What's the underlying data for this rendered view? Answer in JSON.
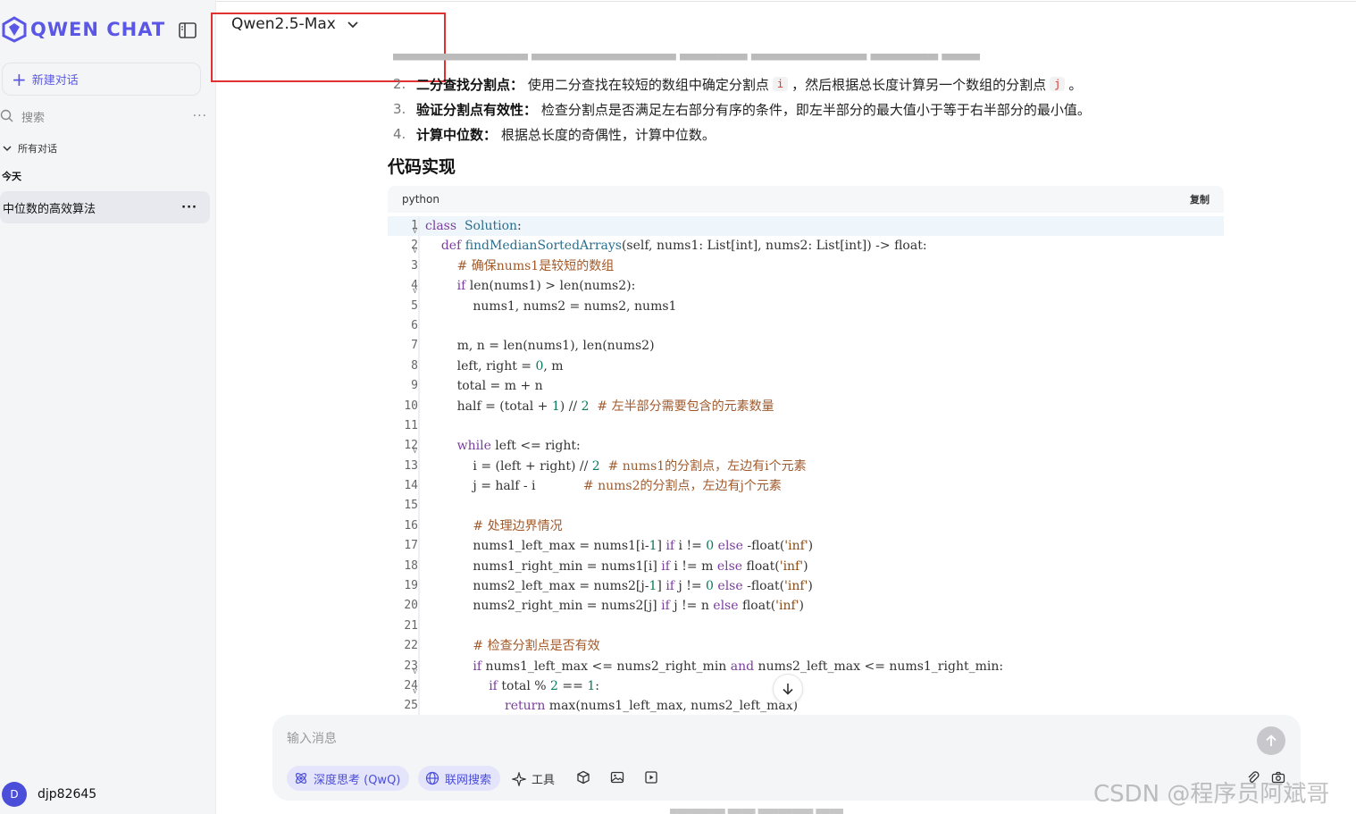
{
  "app": {
    "logo_text": "QWEN CHAT"
  },
  "sidebar": {
    "new_chat_label": "新建对话",
    "search_placeholder": "搜索",
    "all_chats_label": "所有对话",
    "group_today": "今天",
    "conversations": [
      {
        "title": "中位数的高效算法"
      }
    ],
    "user_initial": "D",
    "username": "djp82645"
  },
  "header": {
    "model_name": "Qwen2.5-Max"
  },
  "article": {
    "steps": [
      {
        "num": "2.",
        "title": "二分查找分割点",
        "sep": "：",
        "text_a": "使用二分查找在较短的数组中确定分割点",
        "code_a": "i",
        "text_b": "，然后根据总长度计算另一个数组的分割点",
        "code_b": "j",
        "text_c": "。"
      },
      {
        "num": "3.",
        "title": "验证分割点有效性",
        "sep": "：",
        "text_a": "检查分割点是否满足左右部分有序的条件，即左半部分的最大值小于等于右半部分的最小值。"
      },
      {
        "num": "4.",
        "title": "计算中位数",
        "sep": "：",
        "text_a": "根据总长度的奇偶性，计算中位数。"
      }
    ],
    "section_title": "代码实现",
    "code_block": {
      "language": "python",
      "copy_label": "复制",
      "lines": [
        [
          [
            "kw",
            "class"
          ],
          [
            "",
            "  "
          ],
          [
            "cls",
            "Solution"
          ],
          [
            "",
            ":"
          ]
        ],
        [
          [
            "",
            "    "
          ],
          [
            "kw",
            "def"
          ],
          [
            "",
            " "
          ],
          [
            "cls",
            "findMedianSortedArrays"
          ],
          [
            "",
            "(self, nums1: List[int], nums2: List[int]) -> float:"
          ]
        ],
        [
          [
            "",
            "        "
          ],
          [
            "cmt",
            "# 确保nums1是较短的数组"
          ]
        ],
        [
          [
            "",
            "        "
          ],
          [
            "kw",
            "if"
          ],
          [
            "",
            " len(nums1) > len(nums2):"
          ]
        ],
        [
          [
            "",
            "            nums1, nums2 = nums2, nums1"
          ]
        ],
        [
          [
            "",
            ""
          ]
        ],
        [
          [
            "",
            "        m, n = len(nums1), len(nums2)"
          ]
        ],
        [
          [
            "",
            "        left, right = "
          ],
          [
            "num",
            "0"
          ],
          [
            "",
            ", m"
          ]
        ],
        [
          [
            "",
            "        total = m + n"
          ]
        ],
        [
          [
            "",
            "        half = (total + "
          ],
          [
            "num",
            "1"
          ],
          [
            "",
            ") // "
          ],
          [
            "num",
            "2"
          ],
          [
            "",
            "  "
          ],
          [
            "cmt",
            "# 左半部分需要包含的元素数量"
          ]
        ],
        [
          [
            "",
            ""
          ]
        ],
        [
          [
            "",
            "        "
          ],
          [
            "kw",
            "while"
          ],
          [
            "",
            " left <= right:"
          ]
        ],
        [
          [
            "",
            "            i = (left + right) // "
          ],
          [
            "num",
            "2"
          ],
          [
            "",
            "  "
          ],
          [
            "cmt",
            "# nums1的分割点，左边有i个元素"
          ]
        ],
        [
          [
            "",
            "            j = half - i            "
          ],
          [
            "cmt",
            "# nums2的分割点，左边有j个元素"
          ]
        ],
        [
          [
            "",
            ""
          ]
        ],
        [
          [
            "",
            "            "
          ],
          [
            "cmt",
            "# 处理边界情况"
          ]
        ],
        [
          [
            "",
            "            nums1_left_max = nums1[i-"
          ],
          [
            "num",
            "1"
          ],
          [
            "",
            "] "
          ],
          [
            "kw",
            "if"
          ],
          [
            "",
            " i != "
          ],
          [
            "num",
            "0"
          ],
          [
            "",
            " "
          ],
          [
            "kw",
            "else"
          ],
          [
            "",
            " -float("
          ],
          [
            "str",
            "'inf'"
          ],
          [
            "",
            ")"
          ]
        ],
        [
          [
            "",
            "            nums1_right_min = nums1[i] "
          ],
          [
            "kw",
            "if"
          ],
          [
            "",
            " i != m "
          ],
          [
            "kw",
            "else"
          ],
          [
            "",
            " float("
          ],
          [
            "str",
            "'inf'"
          ],
          [
            "",
            ")"
          ]
        ],
        [
          [
            "",
            "            nums2_left_max = nums2[j-"
          ],
          [
            "num",
            "1"
          ],
          [
            "",
            "] "
          ],
          [
            "kw",
            "if"
          ],
          [
            "",
            " j != "
          ],
          [
            "num",
            "0"
          ],
          [
            "",
            " "
          ],
          [
            "kw",
            "else"
          ],
          [
            "",
            " -float("
          ],
          [
            "str",
            "'inf'"
          ],
          [
            "",
            ")"
          ]
        ],
        [
          [
            "",
            "            nums2_right_min = nums2[j] "
          ],
          [
            "kw",
            "if"
          ],
          [
            "",
            " j != n "
          ],
          [
            "kw",
            "else"
          ],
          [
            "",
            " float("
          ],
          [
            "str",
            "'inf'"
          ],
          [
            "",
            ")"
          ]
        ],
        [
          [
            "",
            ""
          ]
        ],
        [
          [
            "",
            "            "
          ],
          [
            "cmt",
            "# 检查分割点是否有效"
          ]
        ],
        [
          [
            "",
            "            "
          ],
          [
            "kw",
            "if"
          ],
          [
            "",
            " nums1_left_max <= nums2_right_min "
          ],
          [
            "kw",
            "and"
          ],
          [
            "",
            " nums2_left_max <= nums1_right_min:"
          ]
        ],
        [
          [
            "",
            "                "
          ],
          [
            "kw",
            "if"
          ],
          [
            "",
            " total % "
          ],
          [
            "num",
            "2"
          ],
          [
            "",
            " == "
          ],
          [
            "num",
            "1"
          ],
          [
            "",
            ":"
          ]
        ],
        [
          [
            "",
            "                    "
          ],
          [
            "kw",
            "return"
          ],
          [
            "",
            " max(nums1_left_max, nums2_left_max)"
          ]
        ]
      ],
      "fold_lines": [
        1,
        2,
        4,
        12,
        23,
        24
      ]
    }
  },
  "composer": {
    "placeholder": "输入消息",
    "deep_think_label": "深度思考 (QwQ)",
    "web_search_label": "联网搜索",
    "tools_label": "工具"
  },
  "watermark": "CSDN @程序员阿斌哥"
}
